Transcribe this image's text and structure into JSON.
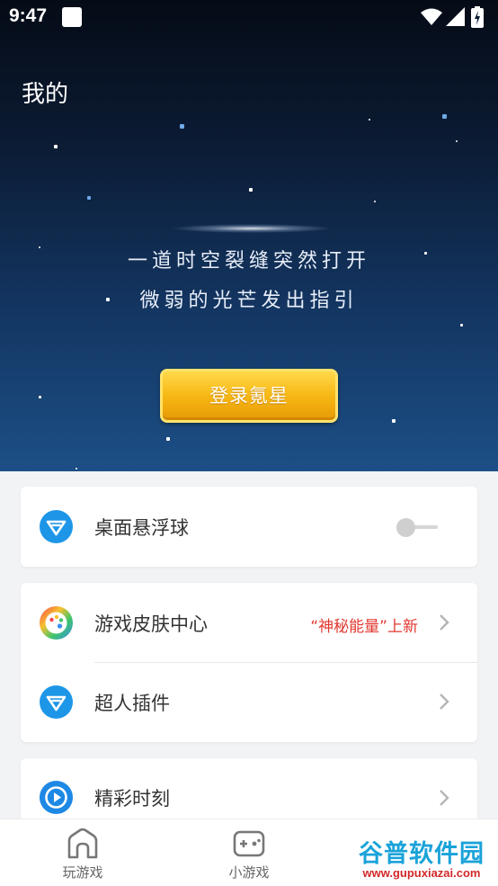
{
  "status_bar": {
    "time": "9:47"
  },
  "header": {
    "title": "我的"
  },
  "hero": {
    "tagline_line1": "一道时空裂缝突然打开",
    "tagline_line2": "微弱的光芒发出指引",
    "login_label": "登录氪星"
  },
  "settings": {
    "float_ball": {
      "label": "桌面悬浮球",
      "icon": "shield-v-icon",
      "enabled": false
    },
    "skin_center": {
      "label": "游戏皮肤中心",
      "note": "“神秘能量”上新",
      "icon": "palette-icon"
    },
    "superman_plugin": {
      "label": "超人插件",
      "icon": "shield-v-icon"
    },
    "highlights": {
      "label": "精彩时刻",
      "icon": "play-icon"
    }
  },
  "bottom_nav": {
    "items": [
      {
        "label": "玩游戏",
        "icon": "home-icon"
      },
      {
        "label": "小游戏",
        "icon": "gamepad-icon"
      }
    ]
  },
  "watermark": {
    "title": "谷普软件园",
    "url": "www.gupuxiazai.com"
  },
  "colors": {
    "accent_blue": "#1e88e5",
    "note_red": "#e2372f",
    "login_gold": "#f7b814"
  }
}
